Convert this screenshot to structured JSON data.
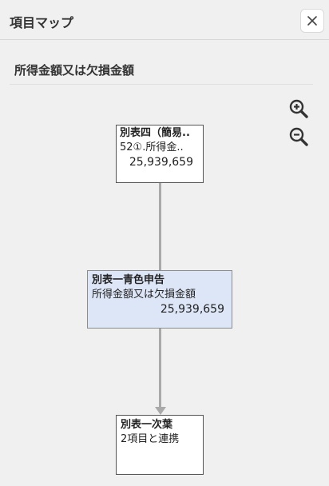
{
  "header": {
    "title": "項目マップ",
    "close_icon": "close-icon"
  },
  "section": {
    "title": "所得金額又は欠損金額"
  },
  "zoom": {
    "in_icon": "zoom-in-icon",
    "out_icon": "zoom-out-icon"
  },
  "nodes": [
    {
      "title": "別表四（簡易..",
      "subtitle": "52①.所得金..",
      "value": "25,939,659"
    },
    {
      "title": "別表一青色申告",
      "subtitle": "所得金額又は欠損金額",
      "value": "25,939,659"
    },
    {
      "title": "別表一次葉",
      "subtitle": "2項目と連携"
    }
  ],
  "colors": {
    "selected_node": "#dde6f6",
    "connector": "#a9a9a9"
  }
}
